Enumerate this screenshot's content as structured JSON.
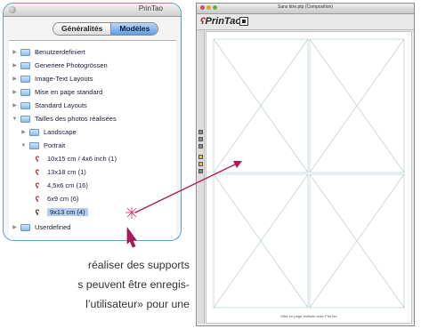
{
  "panel": {
    "title": "PrinTao",
    "tabs": [
      {
        "label": "Généralités",
        "active": false
      },
      {
        "label": "Modèles",
        "active": true
      }
    ],
    "items": [
      {
        "label": "Benutzerdefiniert",
        "level": 0,
        "icon": "folder-icon"
      },
      {
        "label": "Generiere Photogrössen",
        "level": 0,
        "icon": "folder-icon"
      },
      {
        "label": "Image-Text Layouts",
        "level": 0,
        "icon": "folder-icon"
      },
      {
        "label": "Mise en page standard",
        "level": 0,
        "icon": "folder-icon"
      },
      {
        "label": "Standard Layouts",
        "level": 0,
        "icon": "folder-icon"
      },
      {
        "label": "Tailles des photos réalisées",
        "level": 0,
        "expanded": true,
        "icon": "folder-icon"
      },
      {
        "label": "Landscape",
        "level": 1,
        "icon": "folder-icon"
      },
      {
        "label": "Portrait",
        "level": 1,
        "expanded": true,
        "icon": "folder-icon"
      },
      {
        "label": "10x15 cm / 4x6 inch (1)",
        "level": 2,
        "icon": "layout-icon"
      },
      {
        "label": "13x18 cm (1)",
        "level": 2,
        "icon": "layout-icon"
      },
      {
        "label": "4,5x6 cm (16)",
        "level": 2,
        "icon": "layout-icon"
      },
      {
        "label": "6x9 cm (6)",
        "level": 2,
        "icon": "layout-icon"
      },
      {
        "label": "9x13 cm (4)",
        "level": 2,
        "icon": "layout-icon",
        "selected": true
      },
      {
        "label": "Userdefined",
        "level": 0,
        "icon": "folder-icon"
      }
    ]
  },
  "window": {
    "title": "Sans titre.ptp (Composition)",
    "brand": "PrinTao",
    "footer": "Mise en page réalisée avec PrinTao"
  },
  "caption": {
    "lines": [
      "réaliser des supports",
      "s peuvent être enregis-",
      "l’utilisateur» pour une"
    ]
  },
  "colors": {
    "accent_arrow": "#b5165a",
    "selection": "#b4cdf0",
    "panel_border": "#5f9ec8"
  }
}
